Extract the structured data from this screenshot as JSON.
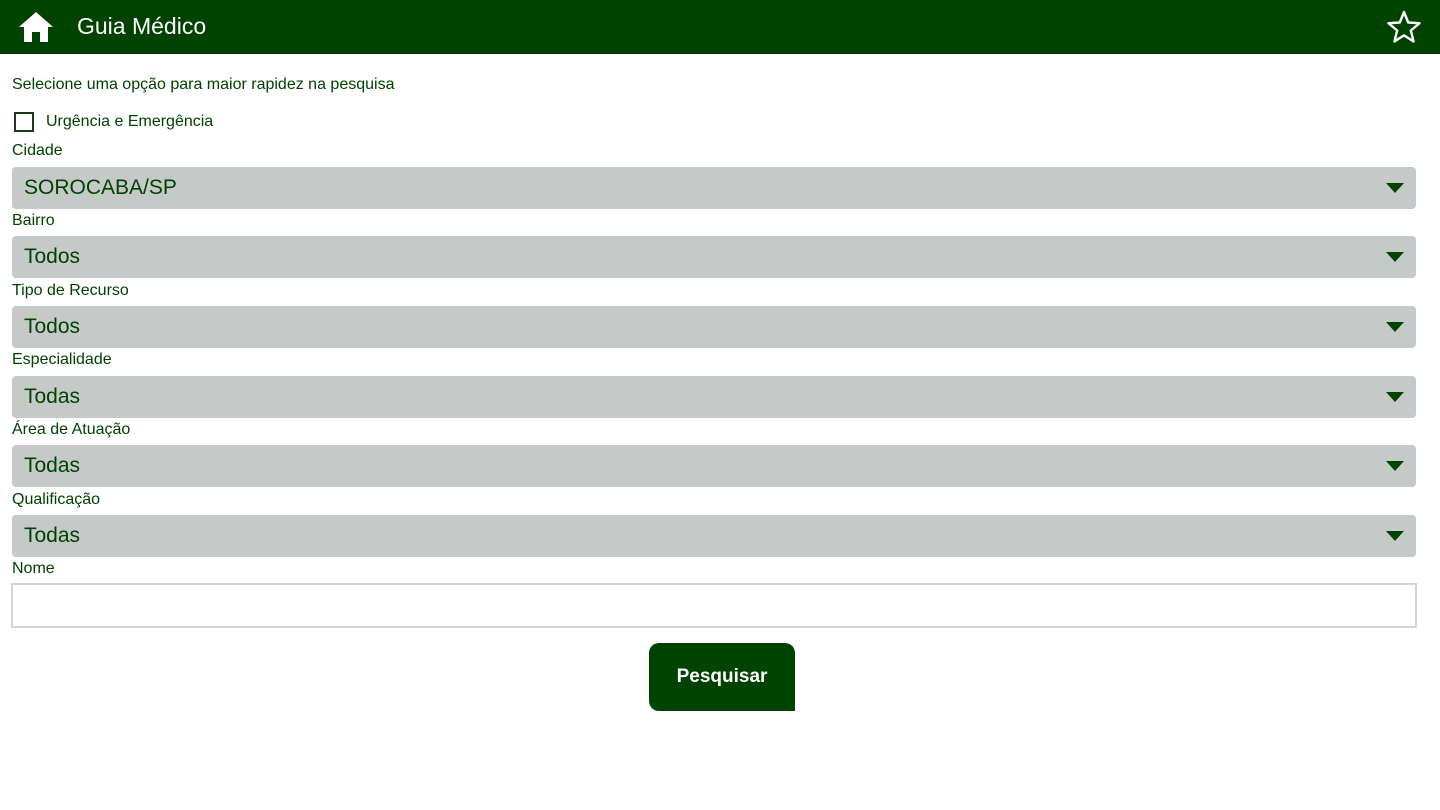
{
  "header": {
    "title": "Guia Médico",
    "home_icon": "home-icon",
    "favorite_icon": "star-outline-icon",
    "background_color": "#004200"
  },
  "form": {
    "hint": "Selecione uma opção para maior rapidez na pesquisa",
    "urgency_checkbox": {
      "label": "Urgência e Emergência",
      "checked": false
    },
    "fields": [
      {
        "label": "Cidade",
        "value": "SOROCABA/SP"
      },
      {
        "label": "Bairro",
        "value": "Todos"
      },
      {
        "label": "Tipo de Recurso",
        "value": "Todos"
      },
      {
        "label": "Especialidade",
        "value": "Todas"
      },
      {
        "label": "Área de Atuação",
        "value": "Todas"
      },
      {
        "label": "Qualificação",
        "value": "Todas"
      }
    ],
    "name_field": {
      "label": "Nome",
      "value": ""
    },
    "search_button_label": "Pesquisar"
  },
  "colors": {
    "accent": "#004200",
    "select_background": "#c5cac9"
  }
}
